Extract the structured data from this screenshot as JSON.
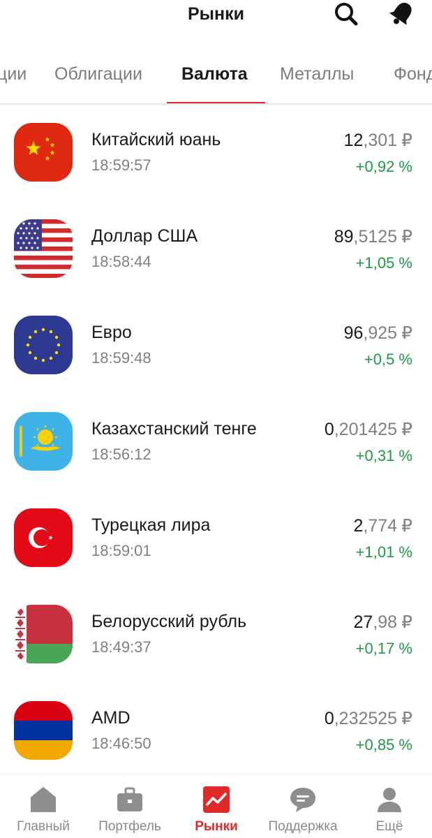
{
  "header": {
    "title": "Рынки"
  },
  "tabs": [
    {
      "label": "Акции",
      "visible": "ции"
    },
    {
      "label": "Облигации"
    },
    {
      "label": "Валюта",
      "active": true
    },
    {
      "label": "Металлы"
    },
    {
      "label": "Фонды",
      "visible": "Фонд"
    }
  ],
  "currencies": [
    {
      "name": "Китайский юань",
      "time": "18:59:57",
      "price_int": "12",
      "price_frac": ",301",
      "currency_sign": "₽",
      "change": "+0,92 %"
    },
    {
      "name": "Доллар США",
      "time": "18:58:44",
      "price_int": "89",
      "price_frac": ",5125",
      "currency_sign": "₽",
      "change": "+1,05 %"
    },
    {
      "name": "Евро",
      "time": "18:59:48",
      "price_int": "96",
      "price_frac": ",925",
      "currency_sign": "₽",
      "change": "+0,5 %"
    },
    {
      "name": "Казахстанский тенге",
      "time": "18:56:12",
      "price_int": "0",
      "price_frac": ",201425",
      "currency_sign": "₽",
      "change": "+0,31 %"
    },
    {
      "name": "Турецкая лира",
      "time": "18:59:01",
      "price_int": "2",
      "price_frac": ",774",
      "currency_sign": "₽",
      "change": "+1,01 %"
    },
    {
      "name": "Белорусский рубль",
      "time": "18:49:37",
      "price_int": "27",
      "price_frac": ",98",
      "currency_sign": "₽",
      "change": "+0,17 %"
    },
    {
      "name": "AMD",
      "time": "18:46:50",
      "price_int": "0",
      "price_frac": ",232525",
      "currency_sign": "₽",
      "change": "+0,85 %"
    }
  ],
  "bottom_nav": [
    {
      "label": "Главный",
      "icon": "home-icon"
    },
    {
      "label": "Портфель",
      "icon": "briefcase-icon"
    },
    {
      "label": "Рынки",
      "icon": "chart-icon",
      "active": true
    },
    {
      "label": "Поддержка",
      "icon": "chat-icon"
    },
    {
      "label": "Ещё",
      "icon": "profile-icon"
    }
  ],
  "colors": {
    "accent": "#e0292b",
    "positive": "#1e9a46",
    "muted": "#808080"
  }
}
